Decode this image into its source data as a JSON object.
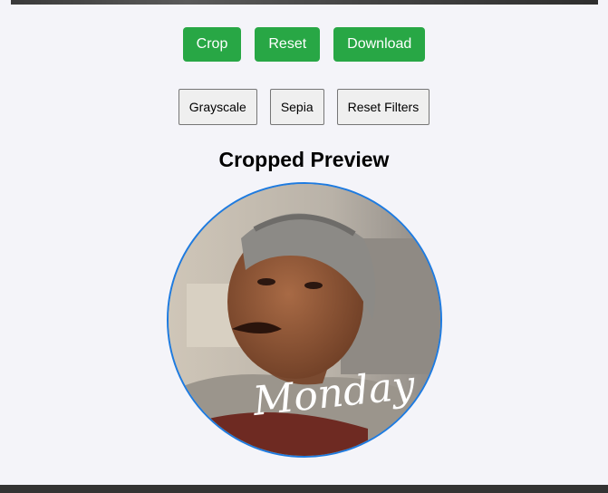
{
  "buttons": {
    "crop": "Crop",
    "reset": "Reset",
    "download": "Download"
  },
  "filters": {
    "grayscale": "Grayscale",
    "sepia": "Sepia",
    "reset_filters": "Reset Filters"
  },
  "preview": {
    "title": "Cropped Preview",
    "watermark": "Monday"
  },
  "colors": {
    "page_background": "#f4f4f9",
    "primary_button": "#28a745",
    "preview_border": "#1e7be0",
    "bottom_bar": "#333333"
  }
}
